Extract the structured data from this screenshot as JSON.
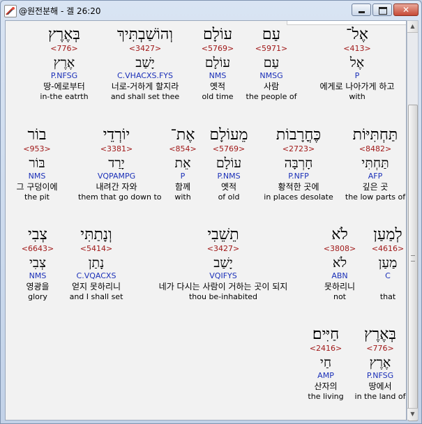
{
  "window": {
    "title": "@원전분해 - 겔 26:20"
  },
  "rows": [
    {
      "words": [
        {
          "heb": "אֶל־",
          "strong": "<413>",
          "lemma": "אֶל",
          "parse": "P",
          "kor": "에게로 나아가게 하고",
          "eng": "with"
        },
        {
          "heb": "עַם",
          "strong": "<5971>",
          "lemma": "עַם",
          "parse": "NMSG",
          "kor": "사람",
          "eng": "the people of"
        },
        {
          "heb": "עוֹלָם",
          "strong": "<5769>",
          "lemma": "עוֹלָם",
          "parse": "NMS",
          "kor": "옛적",
          "eng": "old time"
        },
        {
          "heb": "וְהוֹשַׁבְתִּיךְ",
          "strong": "<3427>",
          "lemma": "יָשַׁב",
          "parse": "C.VHACXS.FYS",
          "kor": "너로-거하게 할지라",
          "eng": "and shall set thee"
        },
        {
          "heb": "בְּאֶרֶץ",
          "strong": "<776>",
          "lemma": "אֶרֶץ",
          "parse": "P.NFSG",
          "kor": "땅-에로부터",
          "eng": "in-the eatrth"
        }
      ]
    },
    {
      "words": [
        {
          "heb": "תַּחְתִּיּוֹת",
          "strong": "<8482>",
          "lemma": "תַּחְתִּי",
          "parse": "AFP",
          "kor": "깊은 곳",
          "eng": "the low parts of"
        },
        {
          "heb": "כֶּחֳרָבוֹת",
          "strong": "<2723>",
          "lemma": "חָרְבָּה",
          "parse": "P.NFP",
          "kor": "황적한 곳에",
          "eng": "in places desolate"
        },
        {
          "heb": "מֵעוֹלָם",
          "strong": "<5769>",
          "lemma": "עוֹלָם",
          "parse": "P.NMS",
          "kor": "옛적",
          "eng": "of old"
        },
        {
          "heb": "אֶת־",
          "strong": "<854>",
          "lemma": "אֵת",
          "parse": "P",
          "kor": "함께",
          "eng": "with"
        },
        {
          "heb": "יוֹרְדֵי",
          "strong": "<3381>",
          "lemma": "יָרַד",
          "parse": "VQPAMPG",
          "kor": "내려간 자와",
          "eng": "them that go down to"
        },
        {
          "heb": "בוֹר",
          "strong": "<953>",
          "lemma": "בּוֹר",
          "parse": "NMS",
          "kor": "그 구덩이에",
          "eng": "the pit"
        }
      ]
    },
    {
      "words": [
        {
          "heb": "לְמַעַן",
          "strong": "<4616>",
          "lemma": "מַעַן",
          "parse": "C",
          "kor": "",
          "eng": "that"
        },
        {
          "heb": "לֹא",
          "strong": "<3808>",
          "lemma": "לֹא",
          "parse": "ABN",
          "kor": "못하리니",
          "eng": "not"
        },
        {
          "heb": "תֵשֵׁבִי",
          "strong": "<3427>",
          "lemma": "יָשַׁב",
          "parse": "VQIFYS",
          "kor": "네가 다시는 사람이 거하는 곳이 되지",
          "eng": "thou be-inhabited"
        },
        {
          "heb": "וְנָתַתִּי",
          "strong": "<5414>",
          "lemma": "נָתַן",
          "parse": "C.VQACXS",
          "kor": "얻지 못하리니",
          "eng": "and I shall set"
        },
        {
          "heb": "צְבִי",
          "strong": "<6643>",
          "lemma": "צְבִי",
          "parse": "NMS",
          "kor": "영광을",
          "eng": "glory"
        }
      ]
    },
    {
      "words": [
        {
          "heb": "בְּאֶרֶץ",
          "strong": "<776>",
          "lemma": "אֶרֶץ",
          "parse": "P.NFSG",
          "kor": "땅에서",
          "eng": "in the land of"
        },
        {
          "heb": "חַיִּים׃",
          "strong": "<2416>",
          "lemma": "חַי",
          "parse": "AMP",
          "kor": "산자의",
          "eng": "the living"
        }
      ]
    }
  ]
}
